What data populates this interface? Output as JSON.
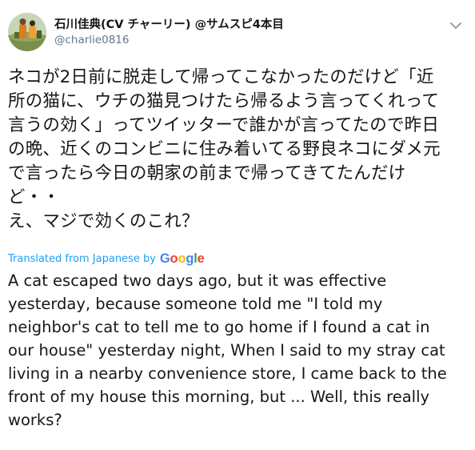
{
  "tweet": {
    "display_name": "石川佳典(CV チャーリー) @サムスピ4本目",
    "handle": "@charlie0816",
    "avatar_icon": "user-avatar-photo",
    "caret_icon": "chevron-down-icon",
    "original_lines": [
      "ネコが2日前に脱走して帰ってこなかったのだけど「近",
      "所の猫に、ウチの猫見つけたら帰るよう言ってくれって",
      "言うの効く」ってツイッターで誰かが言ってたので昨日",
      "の晩、近くのコンビニに住み着いてる野良ネコにダメ元",
      "で言ったら今日の朝家の前まで帰ってきてたんだけ",
      "ど・・",
      "え、マジで効くのこれ？"
    ],
    "translation_label": "Translated from Japanese by",
    "google_letters": [
      {
        "ch": "G",
        "color": "#4285f4"
      },
      {
        "ch": "o",
        "color": "#ea4335"
      },
      {
        "ch": "o",
        "color": "#fbbc05"
      },
      {
        "ch": "g",
        "color": "#4285f4"
      },
      {
        "ch": "l",
        "color": "#34a853"
      },
      {
        "ch": "e",
        "color": "#ea4335"
      }
    ],
    "translated_lines": [
      "A cat escaped two days ago, but it was effective",
      "yesterday, because someone told me \"I told my",
      "neighbor's cat to tell me to go home if I found a cat in",
      "our house\" yesterday night, When I said to my stray cat",
      "living in a nearby convenience store, I came back to the",
      "front of my house this morning, but ... Well, this really",
      "works?"
    ]
  },
  "colors": {
    "text": "#14171a",
    "secondary": "#657786",
    "link": "#1da1f2"
  }
}
